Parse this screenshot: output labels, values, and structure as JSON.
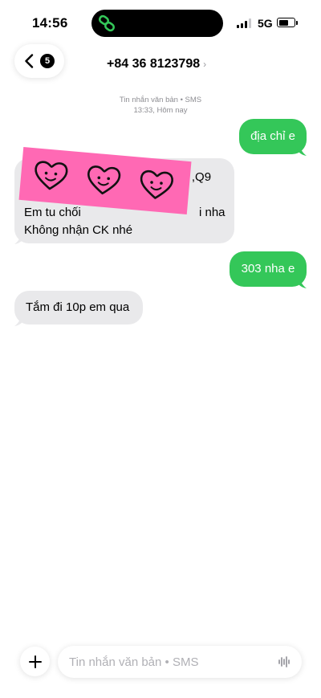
{
  "status_bar": {
    "time": "14:56",
    "network": "5G",
    "signal_bars_active": 3,
    "island_icon": "link-icon",
    "island_icon_color": "#34c759"
  },
  "header": {
    "back_icon": "chevron-left-icon",
    "unread_badge": "5",
    "contact": "+84 36 8123798",
    "contact_chevron": "›"
  },
  "thread_meta": {
    "type": "Tin nhắn văn bản • SMS",
    "time": "13:33, Hôm nay"
  },
  "messages": [
    {
      "side": "sent",
      "text": "địa chỉ e"
    },
    {
      "side": "received",
      "lines": [
        "Phú ,Q9",
        "Em tu chối",
        "i nha",
        "Không nhận CK nhé"
      ]
    },
    {
      "side": "sent",
      "text": "303 nha e"
    },
    {
      "side": "received",
      "text": "Tắm đi 10p em qua"
    }
  ],
  "sticker": {
    "color": "#ff69b4",
    "hearts": 3,
    "icon": "heart-face-icon"
  },
  "composer": {
    "placeholder": "Tin nhắn văn bản • SMS",
    "value": "",
    "add_icon": "plus-icon",
    "voice_icon": "waveform-icon"
  },
  "colors": {
    "sent_bubble": "#34c759",
    "received_bubble": "#e9e9eb",
    "meta_text": "#8e8e93"
  }
}
